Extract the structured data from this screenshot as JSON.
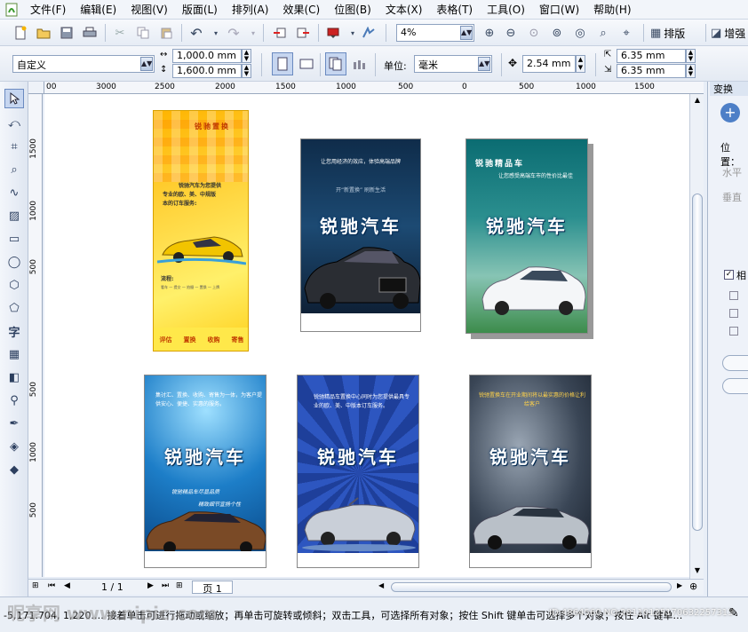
{
  "menu": {
    "items": [
      "文件(F)",
      "编辑(E)",
      "视图(V)",
      "版面(L)",
      "排列(A)",
      "效果(C)",
      "位图(B)",
      "文本(X)",
      "表格(T)",
      "工具(O)",
      "窗口(W)",
      "帮助(H)"
    ]
  },
  "toolbar": {
    "zoom_value": "4%",
    "layout_label": "排版",
    "increase_label": "增强"
  },
  "propbar": {
    "paper_preset": "自定义",
    "width": "1,000.0 mm",
    "height": "1,600.0 mm",
    "unit_label": "单位:",
    "unit_value": "毫米",
    "nudge": "2.54 mm",
    "dup_x": "6.35 mm",
    "dup_y": "6.35 mm"
  },
  "hruler": {
    "ticks": [
      "3000",
      "2500",
      "2000",
      "1500",
      "1000",
      "500",
      "0",
      "500",
      "1000"
    ]
  },
  "vruler": {
    "ticks": [
      "1500",
      "1000",
      "500",
      "1000",
      "500"
    ]
  },
  "canvas": {
    "designs": [
      {
        "title": "锐驰置换",
        "body": [
          "锐驰汽车为您提供",
          "专业的欧、美、中规版",
          "本的订车服务:"
        ],
        "process_label": "流程:",
        "process_steps": "看车 — 提交 — 拍摄 — 置换 — 上牌",
        "footer": [
          "评估",
          "置换",
          "收购",
          "寄售"
        ]
      },
      {
        "tagline": "让您用经济的效应，体验高端品牌",
        "slogan": "开“新置换”  刷新生活",
        "title": "锐驰汽车"
      },
      {
        "heading": "锐驰精品车",
        "tagline": "让您感受高端车市的性价比最佳",
        "title": "锐驰汽车"
      },
      {
        "body": "集讨汇、置换、收购、寄售为一体，为客户提供安心、便捷、实惠的服务。",
        "title": "锐驰汽车",
        "script_lines": [
          "锐驰精品车尽显品质",
          "精致细节宣扬个性"
        ]
      },
      {
        "body": "锐驰精品车置换中心同时为您提供最具专业的欧、美、中版本订车服务。",
        "title": "锐驰汽车"
      },
      {
        "body": "锐驰置换车在开业期间将以最实惠的价格让利给客户",
        "title": "锐驰汽车"
      }
    ]
  },
  "page_nav": {
    "counter": "1 / 1",
    "page_tab": "页 1"
  },
  "docker": {
    "tab": "变换",
    "position_label": "位置：",
    "horizontal_label": "水平",
    "vertical_label": "垂直",
    "relative_label": "相"
  },
  "status": {
    "coords": "-5,171.704, 1,220.…",
    "hint": "接着单击可进行拖动或缩放；再单击可旋转或倾斜；双击工具，可选择所有对象；按住 Shift 键单击可选择多个对象；按住 Alt 键单…",
    "watermark_site": "昵享网 www.nipic.com",
    "watermark_id": "ID:4864560 NO:20110125170632257313"
  }
}
